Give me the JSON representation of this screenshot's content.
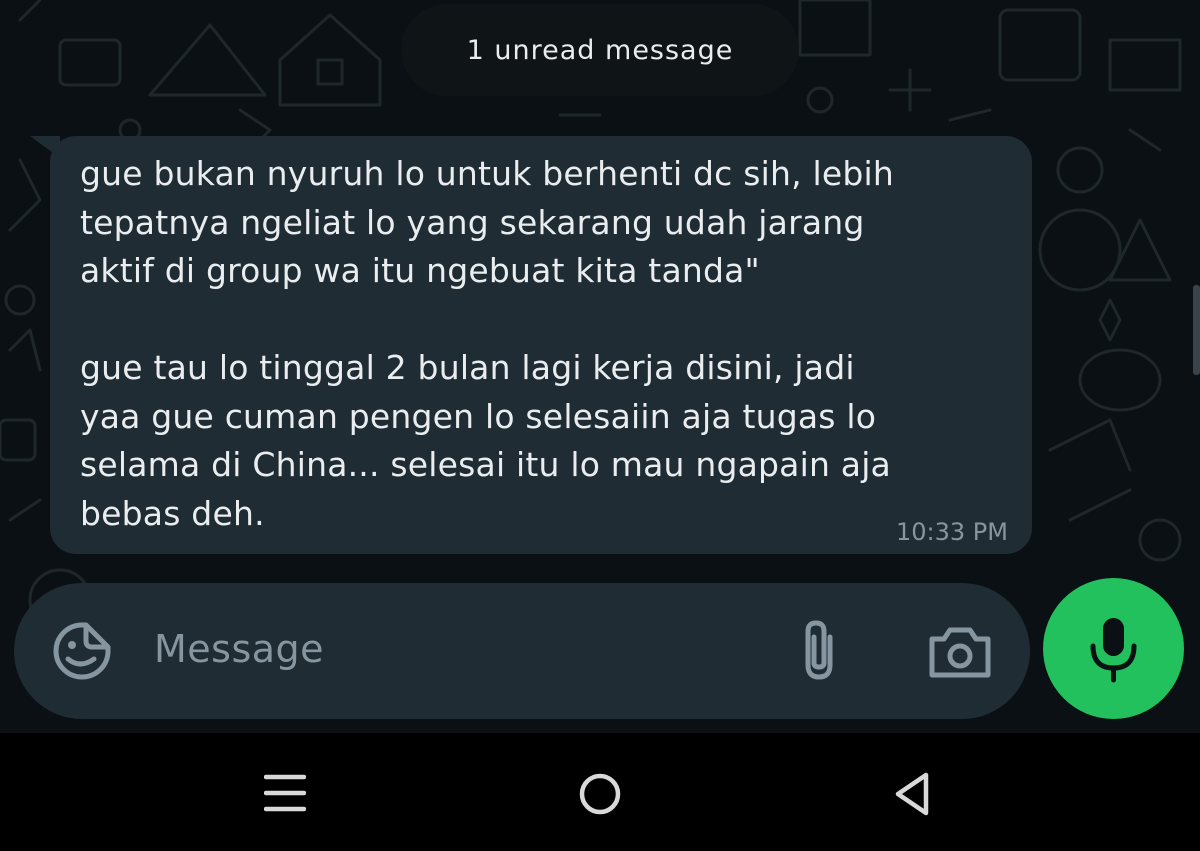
{
  "banner": {
    "unread_label": "1 unread message"
  },
  "message": {
    "text": "gue bukan nyuruh lo untuk berhenti dc sih, lebih\ntepatnya ngeliat lo yang sekarang udah jarang\naktif di group wa itu ngebuat kita tanda\"\n\ngue tau lo tinggal 2 bulan lagi kerja disini, jadi\nyaa gue cuman pengen lo selesaiin aja tugas lo\nselama di China... selesai itu lo mau ngapain aja\nbebas deh.",
    "time": "10:33 PM"
  },
  "composer": {
    "placeholder": "Message",
    "emoji_icon": "sticker-emoji-icon",
    "attach_icon": "paperclip-icon",
    "camera_icon": "camera-icon",
    "mic_icon": "microphone-icon"
  },
  "nav": {
    "recents_icon": "recents-icon",
    "home_icon": "home-icon",
    "back_icon": "back-icon"
  },
  "colors": {
    "background": "#0b1014",
    "bubble": "#202c33",
    "composer": "#1f2c33",
    "accent_green": "#22c15e",
    "text_primary": "#e9edef",
    "text_secondary": "#8696a0"
  }
}
